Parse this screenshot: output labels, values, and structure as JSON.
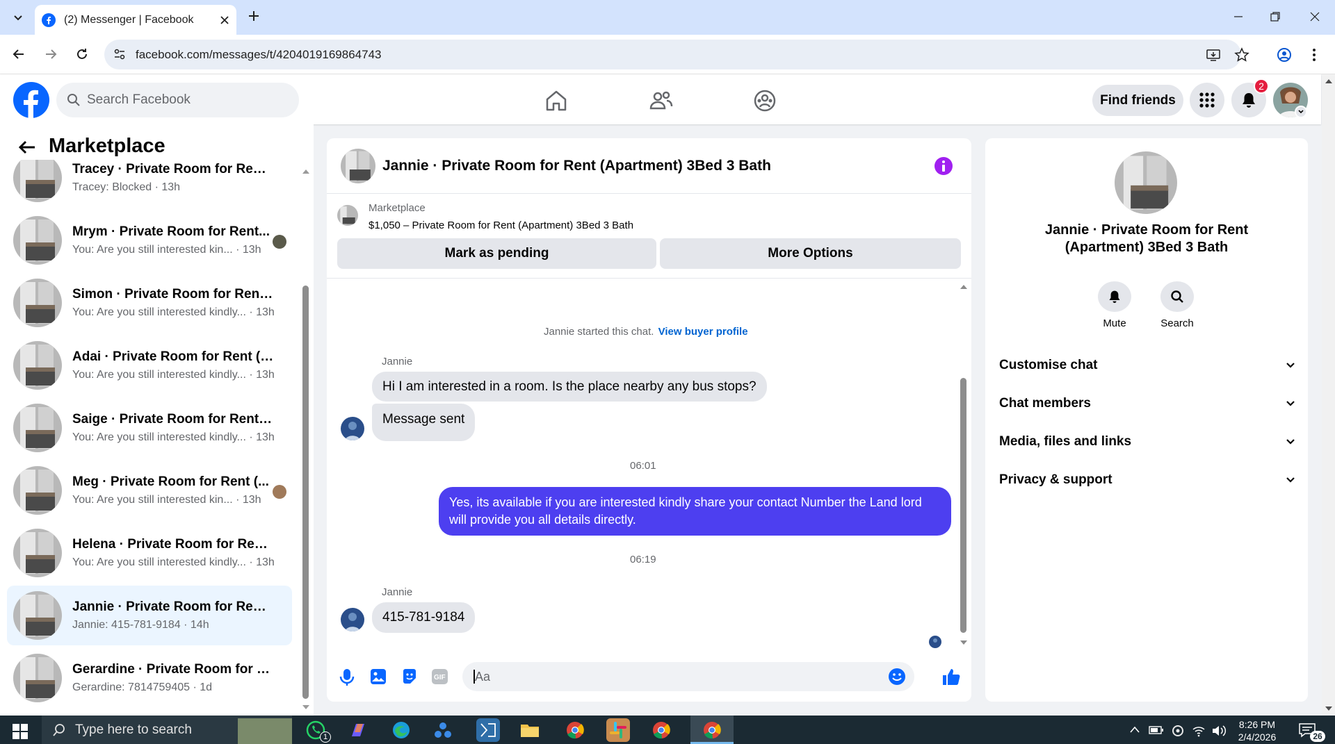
{
  "browser": {
    "tab_title": "(2) Messenger | Facebook",
    "url": "facebook.com/messages/t/4204019169864743"
  },
  "header": {
    "search_placeholder": "Search Facebook",
    "find_friends": "Find friends",
    "notification_count": "2"
  },
  "sidebar": {
    "title": "Marketplace",
    "conversations": [
      {
        "name": "Tracey · Private Room for Rent (...",
        "sub": "Tracey: Blocked · 13h"
      },
      {
        "name": "Mrym · Private Room for Rent...",
        "sub": "You: Are you still interested kin... · 13h"
      },
      {
        "name": "Simon · Private Room for Rent (...",
        "sub": "You: Are you still interested kindly... · 13h"
      },
      {
        "name": "Adai · Private Room for Rent (A...",
        "sub": "You: Are you still interested kindly... · 13h"
      },
      {
        "name": "Saige · Private Room for Rent (A...",
        "sub": "You: Are you still interested kindly... · 13h"
      },
      {
        "name": "Meg · Private Room for Rent (...",
        "sub": "You: Are you still interested kin... · 13h"
      },
      {
        "name": "Helena · Private Room for Rent (...",
        "sub": "You: Are you still interested kindly... · 13h"
      },
      {
        "name": "Jannie · Private Room for Rent (...",
        "sub": "Jannie: 415-781-9184 · 14h"
      },
      {
        "name": "Gerardine · Private Room for Re...",
        "sub": "Gerardine: 7814759405 · 1d"
      }
    ]
  },
  "chat": {
    "title": "Jannie · Private Room for Rent (Apartment) 3Bed 3 Bath",
    "listing_label": "Marketplace",
    "listing_detail": "$1,050 – Private Room for Rent (Apartment) 3Bed 3 Bath",
    "mark_pending": "Mark as pending",
    "more_options": "More Options",
    "started_text": "Jannie started this chat.",
    "view_profile": "View buyer profile",
    "sender_name_1": "Jannie",
    "msg1": "Hi I am interested in a room. Is the place nearby any bus stops?",
    "msg2": "Message sent",
    "time1": "06:01",
    "msg3": "Yes, its available if you are interested kindly share your contact Number the Land lord will provide you all details directly.",
    "time2": "06:19",
    "sender_name_2": "Jannie",
    "msg4": "415-781-9184",
    "composer_placeholder": "Aa"
  },
  "info_panel": {
    "title": "Jannie · Private Room for Rent (Apartment) 3Bed 3 Bath",
    "mute": "Mute",
    "search": "Search",
    "sections": [
      "Customise chat",
      "Chat members",
      "Media, files and links",
      "Privacy & support"
    ]
  },
  "taskbar": {
    "search_placeholder": "Type here to search",
    "time": "8:26 PM",
    "date": "2/4/2026",
    "notif_badge": "26",
    "whatsapp_badge": "1"
  },
  "colors": {
    "fb_blue": "#0866ff",
    "outgoing_bubble": "#4d3ff0",
    "info_icon": "#a020f0"
  }
}
